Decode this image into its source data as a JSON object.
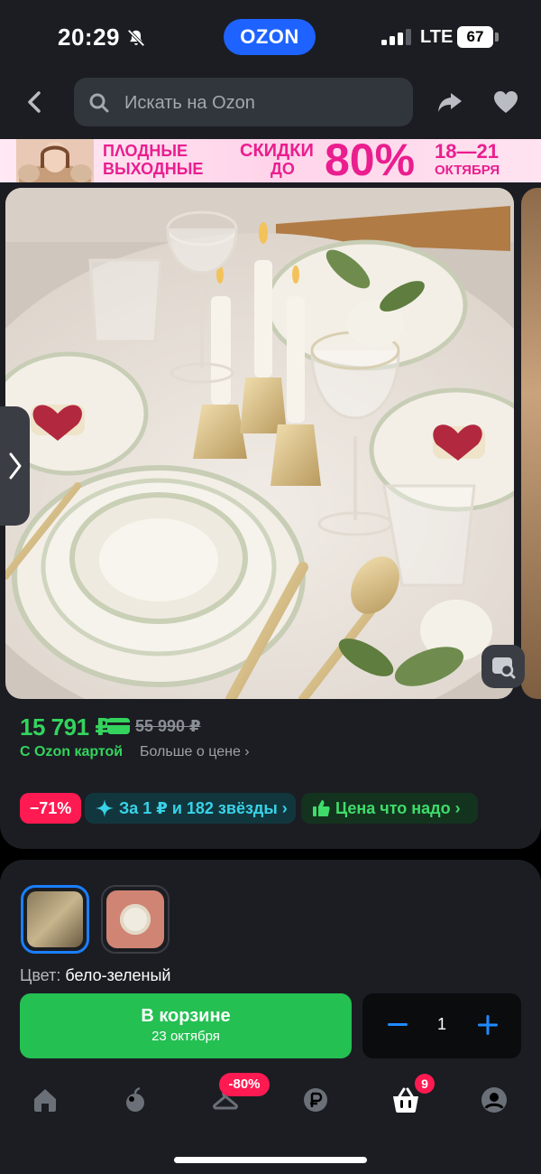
{
  "status_bar": {
    "time": "20:29",
    "brand": "OZON",
    "network": "LTE",
    "battery": "67"
  },
  "header": {
    "search_placeholder": "Искать на Ozon"
  },
  "banner": {
    "line1": "ΠΛΟДНЫЕ",
    "line2": "ВЫХОДНЫЕ",
    "discount_word": "СКИДКИ",
    "upto": "ДО",
    "percent": "80%",
    "dates": "18—21",
    "month": "ОКТЯБРЯ"
  },
  "product": {
    "price": "15 791 ₽",
    "old_price": "55 990 ₽",
    "with_card": "С Ozon картой",
    "more_price": "Больше о цене ›",
    "chips": {
      "discount": "−71%",
      "stars": "За 1 ₽ и 182 звёзды ›",
      "fair_price": "Цена что надо ›"
    }
  },
  "variant": {
    "color_label": "Цвет: ",
    "color_value": "бело-зеленый"
  },
  "cart": {
    "button_label": "В корзине",
    "delivery": "23 октября",
    "quantity": "1"
  },
  "tabbar": {
    "promo_badge": "-80%",
    "cart_badge": "9"
  },
  "colors": {
    "accent_green": "#24c052",
    "price_green": "#34d35e",
    "brand_blue": "#1e63ff",
    "badge_red": "#ff1a52",
    "banner_pink": "#ea1e8f"
  }
}
